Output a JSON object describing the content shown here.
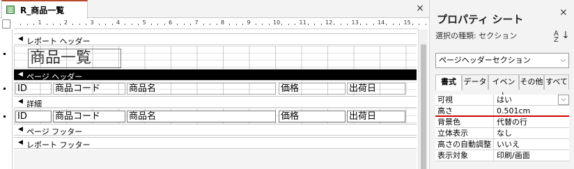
{
  "tab": {
    "title": "R_商品一覧",
    "close": "×"
  },
  "ruler": {
    "numbers": [
      "1",
      "2",
      "3",
      "4",
      "5",
      "6",
      "7",
      "8",
      "9",
      "10",
      "11",
      "12",
      "13",
      "14",
      "15"
    ]
  },
  "bands": {
    "report_header": "レポート ヘッダー",
    "page_header": "ページ ヘッダー",
    "detail": "詳細",
    "page_footer": "ページ フッター",
    "report_footer": "レポート フッター",
    "arrow": "◀"
  },
  "report_title": "商品一覧",
  "columns": [
    "ID",
    "商品コード",
    "商品名",
    "価格",
    "出荷日"
  ],
  "property_sheet": {
    "title": "プロパティ シート",
    "close": "×",
    "selection_type": "選択の種類: セクション",
    "sort_icon_top": "A",
    "sort_icon_bottom": "Z",
    "sort_arrow": "↓",
    "dropdown_value": "ページヘッダーセクション",
    "dropdown_chevron": "⌵",
    "tabs": [
      "書式",
      "データ",
      "イベント",
      "その他",
      "すべて"
    ],
    "rows": [
      {
        "name": "可視",
        "value": "はい",
        "chevron": "⌵"
      },
      {
        "name": "高さ",
        "value": "0.501cm"
      },
      {
        "name": "背景色",
        "value": "代替の行"
      },
      {
        "name": "立体表示",
        "value": "なし"
      },
      {
        "name": "高さの自動調整",
        "value": "いいえ"
      },
      {
        "name": "表示対象",
        "value": "印刷/画面"
      }
    ]
  },
  "colors": {
    "accent_tab": "#b7472a",
    "highlight_line": "#d00000"
  }
}
